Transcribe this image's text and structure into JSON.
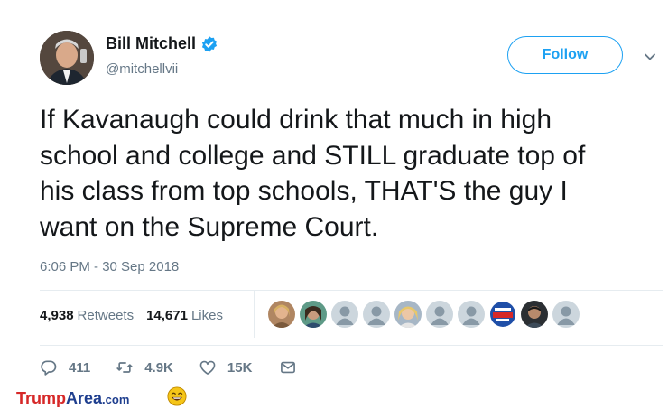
{
  "user": {
    "name": "Bill Mitchell",
    "handle": "@mitchellvii",
    "verified": true
  },
  "follow_button": {
    "label": "Follow"
  },
  "tweet": {
    "text": "If Kavanaugh could drink that much in high\nschool and college and STILL graduate top of\nhis class from top schools, THAT'S the guy I\nwant on the Supreme Court.",
    "timestamp": "6:06 PM - 30 Sep 2018"
  },
  "stats": {
    "retweets_count": "4,938",
    "retweets_label": "Retweets",
    "likes_count": "14,671",
    "likes_label": "Likes"
  },
  "liker_faces": [
    {
      "icon": "user-photo-icon"
    },
    {
      "icon": "user-photo-icon"
    },
    {
      "icon": "default-avatar-icon"
    },
    {
      "icon": "default-avatar-icon"
    },
    {
      "icon": "user-photo-icon"
    },
    {
      "icon": "default-avatar-icon"
    },
    {
      "icon": "default-avatar-icon"
    },
    {
      "icon": "logo-avatar-icon"
    },
    {
      "icon": "user-photo-icon"
    },
    {
      "icon": "default-avatar-icon"
    }
  ],
  "actions": {
    "reply_count": "411",
    "retweet_count": "4.9K",
    "like_count": "15K"
  },
  "watermark": {
    "part1": "Trump",
    "part2": "Area",
    "part3": ".com"
  },
  "colors": {
    "accent": "#1da1f2",
    "text": "#14171a",
    "secondary": "#657786",
    "divider": "#e6ecf0"
  }
}
